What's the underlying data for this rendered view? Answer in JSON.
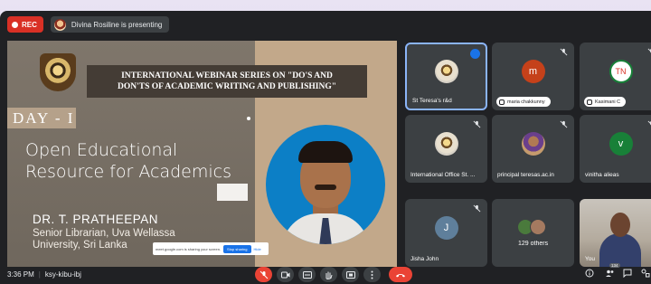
{
  "topbar": {
    "rec_label": "REC",
    "presenter_text": "Divina Rosiline is presenting"
  },
  "slide": {
    "title_line1": "INTERNATIONAL WEBINAR SERIES ON \"DO'S AND",
    "title_line2": "DON'TS OF ACADEMIC WRITING AND PUBLISHING\"",
    "day": "DAY - I",
    "topic_line1": "Open Educational",
    "topic_line2": "Resource for Academics",
    "speaker_name": "DR. T. PRATHEEPAN",
    "speaker_role_line1": "Senior Librarian, Uva Wellassa",
    "speaker_role_line2": "University, Sri Lanka",
    "share_text": "meet.google.com is sharing your screen.",
    "share_stop": "Stop sharing",
    "share_hide": "Hide"
  },
  "participants": [
    {
      "name": "St Teresa's r&d",
      "avatar": "crest",
      "active": true
    },
    {
      "name": "maria chakkunny",
      "avatar_letter": "m",
      "color": "#c5411a",
      "chip": true
    },
    {
      "name": "Kasimani C",
      "avatar_letter": "TN",
      "color": "#d93025",
      "chip": true
    },
    {
      "name": "International Office St. ...",
      "avatar": "crest"
    },
    {
      "name": "principal teresas.ac.in",
      "avatar": "photo"
    },
    {
      "name": "vinitha alieas",
      "avatar_letter": "v",
      "color": "#188038"
    },
    {
      "name": "Jisha John",
      "avatar_letter": "J",
      "color": "#5f7f9b"
    },
    {
      "name": "129 others"
    },
    {
      "name": "You"
    }
  ],
  "bottombar": {
    "time": "3:36 PM",
    "meeting_code": "ksy-kibu-ibj",
    "participant_count": "134"
  }
}
